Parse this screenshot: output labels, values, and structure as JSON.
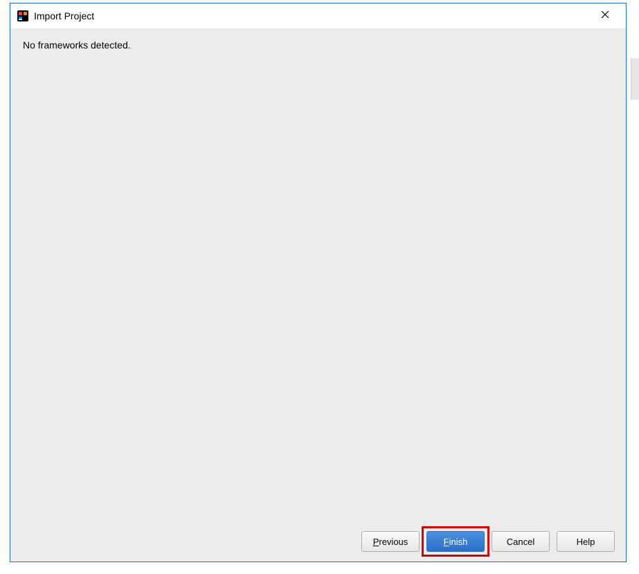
{
  "titlebar": {
    "title": "Import Project"
  },
  "content": {
    "message": "No frameworks detected."
  },
  "buttons": {
    "previous": {
      "mnemonic": "P",
      "rest": "revious"
    },
    "finish": {
      "mnemonic": "F",
      "rest": "inish"
    },
    "cancel": {
      "label": "Cancel"
    },
    "help": {
      "label": "Help"
    }
  },
  "highlight": {
    "target": "finish-button"
  }
}
